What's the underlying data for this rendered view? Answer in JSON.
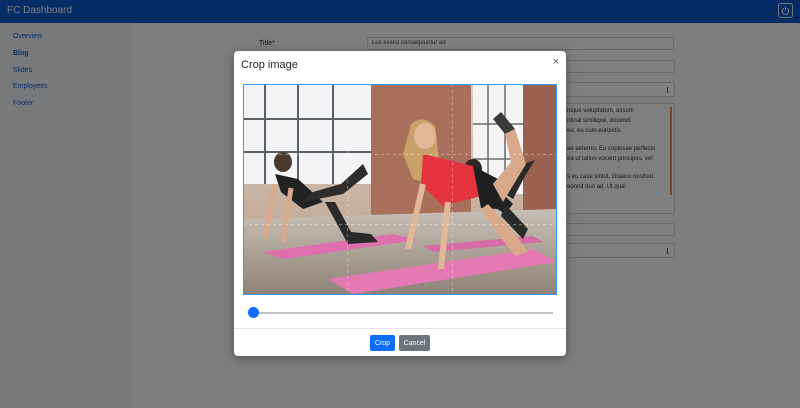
{
  "app": {
    "title": "FC Dashboard",
    "power_icon": "power-icon"
  },
  "sidebar": {
    "items": [
      {
        "label": "Overview",
        "active": false
      },
      {
        "label": "Blog",
        "active": true
      },
      {
        "label": "Slides",
        "active": false
      },
      {
        "label": "Employees",
        "active": false
      },
      {
        "label": "Footer",
        "active": false
      }
    ]
  },
  "form": {
    "title_label": "Title*",
    "title_value": "Lus exerci consequuntur ad",
    "body_lines": [
      "nique voluptatum, assum",
      "ntinal similique, docendi",
      "eu, eu cum euripidis",
      "ae aeterno. Eu copiosae perfecto",
      "ea ut tation vocent principes, vel",
      "s eu case sintul. Graeco nostrud",
      "eonnit duo ad. Ut qual"
    ]
  },
  "modal": {
    "title": "Crop image",
    "close_symbol": "×",
    "zoom_level": 0.0,
    "crop_button": "Crop",
    "cancel_button": "Cancel"
  },
  "colors": {
    "topbar": "#0a58ca",
    "primary": "#0d6efd",
    "secondary": "#6c757d",
    "mat_pink": "#e06fae",
    "shirt_red": "#e2333f"
  }
}
